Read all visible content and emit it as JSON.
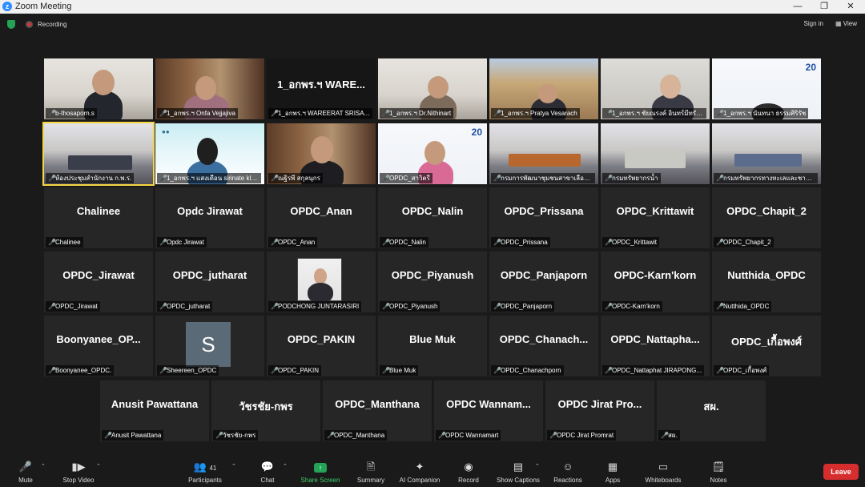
{
  "window": {
    "title": "Zoom Meeting"
  },
  "topbar": {
    "recording": "Recording",
    "sign_in": "Sign in",
    "view": "View"
  },
  "participants_video": [
    {
      "label": "b-thosaporn.s",
      "bg": "office"
    },
    {
      "label": "1_อกพร.ฯ Onfa Vejjajiva",
      "bg": "books"
    },
    {
      "label": "1_อกพร.ฯ WAREERAT SRISAT...",
      "big": "1_อกพร.ฯ WARE...",
      "bg": "black"
    },
    {
      "label": "1_อกพร.ฯ Dr.Nithinart",
      "bg": "office"
    },
    {
      "label": "1_อกพร.ฯ Pratya Vesarach",
      "bg": "church"
    },
    {
      "label": "1_อกพร.ฯ ชัยณรงค์ อินทร์มีทรัพย์",
      "bg": "grey"
    },
    {
      "label": "1_อกพร.ฯ นันทนา ธรรมศิริรัช",
      "bg": "white",
      "logo": "20"
    },
    {
      "label": "ห้องประชุมสำนักงาน ก.พ.ร.",
      "bg": "room",
      "active": true
    },
    {
      "label": "1_อกพร.ฯ แสงเดือน sirinate kla...",
      "bg": "teal"
    },
    {
      "label": "ณฐิรพี สกุลนุกร",
      "bg": "books"
    },
    {
      "label": "OPDC_สาวิตรี",
      "bg": "white",
      "logo": "20"
    },
    {
      "label": "กรมการพัฒนาชุมชนสาขาเลือกศรีสะเกษ...",
      "bg": "room"
    },
    {
      "label": "กรมทรัพยากรน้ำ",
      "bg": "room"
    },
    {
      "label": "กรมทรัพยากรทางทะเลและชายฝั่ง...",
      "bg": "room"
    }
  ],
  "participants_name": [
    {
      "big": "Chalinee",
      "label": "Chalinee"
    },
    {
      "big": "Opdc Jirawat",
      "label": "Opdc Jirawat"
    },
    {
      "big": "OPDC_Anan",
      "label": "OPDC_Anan"
    },
    {
      "big": "OPDC_Nalin",
      "label": "OPDC_Nalin"
    },
    {
      "big": "OPDC_Prissana",
      "label": "OPDC_Prissana"
    },
    {
      "big": "OPDC_Krittawit",
      "label": "OPDC_Krittawit"
    },
    {
      "big": "OPDC_Chapit_2",
      "label": "OPDC_Chapit_2"
    },
    {
      "big": "OPDC_Jirawat",
      "label": "OPDC_Jirawat"
    },
    {
      "big": "OPDC_jutharat",
      "label": "OPDC_jutharat"
    },
    {
      "big": "",
      "label": "PODCHONG JUNTARASIRI",
      "photo": true
    },
    {
      "big": "OPDC_Piyanush",
      "label": "OPDC_Piyanush"
    },
    {
      "big": "OPDC_Panjaporn",
      "label": "OPDC_Panjaporn"
    },
    {
      "big": "OPDC-Karn'korn",
      "label": "OPDC-Karn'korn"
    },
    {
      "big": "Nutthida_OPDC",
      "label": "Nutthida_OPDC"
    },
    {
      "big": "Boonyanee_OP...",
      "label": "Boonyanee_OPDC."
    },
    {
      "big": "",
      "label": "Sheereen_OPDC",
      "avatar": "S"
    },
    {
      "big": "OPDC_PAKIN",
      "label": "OPDC_PAKIN"
    },
    {
      "big": "Blue Muk",
      "label": "Blue Muk"
    },
    {
      "big": "OPDC_Chanach...",
      "label": "OPDC_Chanachporn"
    },
    {
      "big": "OPDC_Nattapha...",
      "label": "OPDC_Nattaphat JIRAPONG..."
    },
    {
      "big": "OPDC_เกื้อพงศ์",
      "label": "OPDC_เกื้อพงศ์"
    },
    {
      "big": "Anusit Pawattana",
      "label": "Anusit Pawattana"
    },
    {
      "big": "วัชรชัย-กพร",
      "label": "วัชรชัย-กพร"
    },
    {
      "big": "OPDC_Manthana",
      "label": "OPDC_Manthana"
    },
    {
      "big": "OPDC  Wannam...",
      "label": "OPDC Wannamart"
    },
    {
      "big": "OPDC  Jirat Pro...",
      "label": "OPDC Jirat Promrat"
    },
    {
      "big": "สผ.",
      "label": "สผ."
    }
  ],
  "toolbar": {
    "mute": "Mute",
    "stop_video": "Stop Video",
    "participants": "Participants",
    "participants_count": "41",
    "chat": "Chat",
    "share_screen": "Share Screen",
    "summary": "Summary",
    "ai_companion": "AI Companion",
    "record": "Record",
    "show_captions": "Show Captions",
    "reactions": "Reactions",
    "apps": "Apps",
    "whiteboards": "Whiteboards",
    "notes": "Notes",
    "leave": "Leave"
  },
  "colors": {
    "accent_green": "#23a455",
    "leave_red": "#d62e2e",
    "active_border": "#f5d641",
    "mic_muted": "#e02f2f"
  }
}
